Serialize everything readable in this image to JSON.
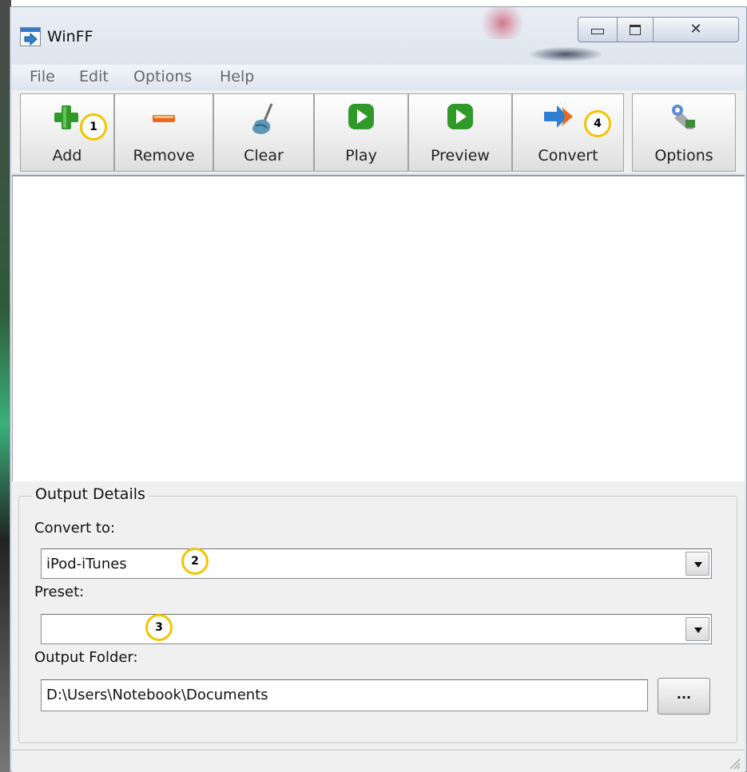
{
  "window": {
    "title": "WinFF"
  },
  "menu": {
    "items": [
      "File",
      "Edit",
      "Options",
      "Help"
    ]
  },
  "toolbar": {
    "add": "Add",
    "remove": "Remove",
    "clear": "Clear",
    "play": "Play",
    "preview": "Preview",
    "convert": "Convert",
    "options": "Options"
  },
  "markers": [
    "1",
    "2",
    "3",
    "4"
  ],
  "output": {
    "group_title": "Output Details",
    "convert_to_label": "Convert to:",
    "convert_to_value": "iPod-iTunes",
    "preset_label": "Preset:",
    "preset_value": "",
    "folder_label": "Output Folder:",
    "folder_value": "D:\\Users\\Notebook\\Documents",
    "browse_label": "..."
  },
  "colors": {
    "accent_green": "#2f9a2a",
    "marker_ring": "#f3c400",
    "remove_orange": "#e8691d"
  }
}
